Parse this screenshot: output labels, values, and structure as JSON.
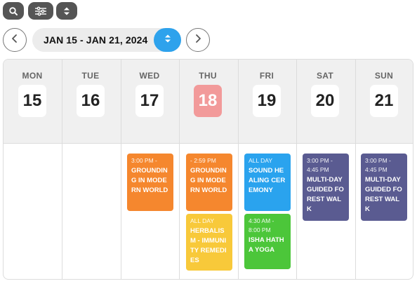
{
  "toolbar": {
    "buttons": [
      {
        "name": "search-button",
        "icon": "search-icon"
      },
      {
        "name": "filter-button",
        "icon": "sliders-icon"
      },
      {
        "name": "view-toggle-button",
        "icon": "up-down-chevron-icon"
      }
    ]
  },
  "nav": {
    "prev_icon": "chevron-left-icon",
    "next_icon": "chevron-right-icon",
    "date_range": "JAN 15 - JAN 21, 2024",
    "range_toggle_icon": "up-down-chevron-icon"
  },
  "colors": {
    "toolbar": "#555555",
    "accent_blue": "#2ea2ec",
    "today": "#f29a9a",
    "orange": "#f5872e",
    "blue": "#2aa3ee",
    "yellow": "#f8c93a",
    "green": "#4cc63a",
    "purple": "#5a5b91"
  },
  "days": [
    {
      "name": "MON",
      "date": "15",
      "today": false
    },
    {
      "name": "TUE",
      "date": "16",
      "today": false
    },
    {
      "name": "WED",
      "date": "17",
      "today": false
    },
    {
      "name": "THU",
      "date": "18",
      "today": true
    },
    {
      "name": "FRI",
      "date": "19",
      "today": false
    },
    {
      "name": "SAT",
      "date": "20",
      "today": false
    },
    {
      "name": "SUN",
      "date": "21",
      "today": false
    }
  ],
  "events": [
    {
      "day": "WED",
      "time": "3:00 PM -",
      "title": "GROUNDING IN MODERN WORLD",
      "color": "orange"
    },
    {
      "day": "THU",
      "time": "- 2:59 PM",
      "title": "GROUNDING IN MODERN WORLD",
      "color": "orange"
    },
    {
      "day": "THU",
      "time": "ALL DAY",
      "title": "HERBALISM - IMMUNITY REMEDIES",
      "color": "yellow"
    },
    {
      "day": "FRI",
      "time": "ALL DAY",
      "title": "SOUND HEALING CEREMONY",
      "color": "blue"
    },
    {
      "day": "FRI",
      "time": "4:30 AM - 8:00 PM",
      "title": "ISHA HATHA YOGA",
      "color": "green"
    },
    {
      "day": "SAT",
      "time": "3:00 PM - 4:45 PM",
      "title": "MULTI-DAY GUIDED FOREST WALK",
      "color": "purple"
    },
    {
      "day": "SUN",
      "time": "3:00 PM - 4:45 PM",
      "title": "MULTI-DAY GUIDED FOREST WALK",
      "color": "purple"
    }
  ]
}
